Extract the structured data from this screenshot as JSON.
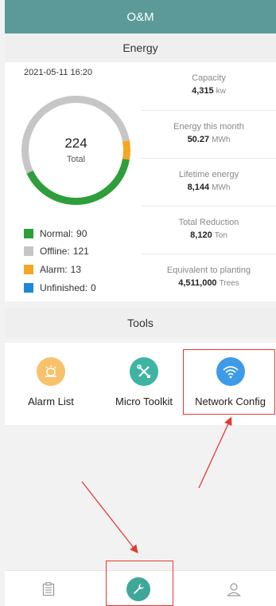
{
  "header": {
    "title": "O&M"
  },
  "energy": {
    "section_title": "Energy",
    "timestamp": "2021-05-11 16:20",
    "total_count": "224",
    "total_label": "Total",
    "status_distribution": {
      "normal": 90,
      "offline": 121,
      "alarm": 13,
      "unfinished": 0
    },
    "legend": [
      {
        "label": "Normal:",
        "value": "90",
        "color": "#2e9e3a"
      },
      {
        "label": "Offline:",
        "value": "121",
        "color": "#c6c6c6"
      },
      {
        "label": "Alarm:",
        "value": "13",
        "color": "#f5a623"
      },
      {
        "label": "Unfinished:",
        "value": "0",
        "color": "#1e88d6"
      }
    ],
    "stats": [
      {
        "label": "Capacity",
        "value": "4,315",
        "unit": "kw"
      },
      {
        "label": "Energy this month",
        "value": "50.27",
        "unit": "MWh"
      },
      {
        "label": "Lifetime energy",
        "value": "8,144",
        "unit": "MWh"
      },
      {
        "label": "Total Reduction",
        "value": "8,120",
        "unit": "Ton"
      },
      {
        "label": "Equivalent to planting",
        "value": "4,511,000",
        "unit": "Trees"
      }
    ]
  },
  "tools": {
    "section_title": "Tools",
    "items": [
      {
        "label": "Alarm List",
        "icon": "alarm-bell-icon",
        "color": "#f7c26b"
      },
      {
        "label": "Micro Toolkit",
        "icon": "tools-icon",
        "color": "#3fb4a3"
      },
      {
        "label": "Network Config",
        "icon": "wifi-icon",
        "color": "#3d9be9"
      }
    ]
  },
  "tabbar": {
    "tabs": [
      {
        "icon": "clipboard-icon"
      },
      {
        "icon": "wrench-icon",
        "active": true,
        "color": "#3fa79a"
      },
      {
        "icon": "user-icon"
      }
    ]
  },
  "colors": {
    "header": "#5b9a98",
    "highlight": "#e53935"
  }
}
